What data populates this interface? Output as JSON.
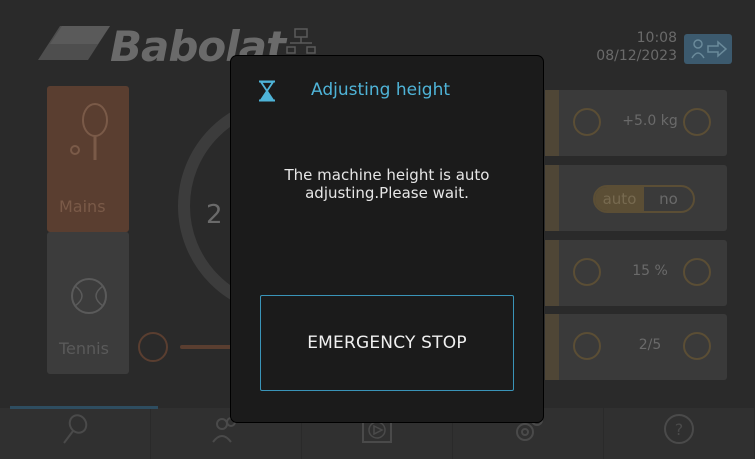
{
  "header": {
    "brand": "Babolat",
    "time": "10:08",
    "date": "08/12/2023"
  },
  "modes": [
    {
      "label": "Mains",
      "icon": "racket-icon",
      "selected": true
    },
    {
      "label": "Tennis",
      "icon": "tennis-ball-icon",
      "selected": false
    }
  ],
  "dial": {
    "value_fragment": "2"
  },
  "settings": {
    "weight": "+5.0 kg",
    "auto_toggle": {
      "on": "auto",
      "off": "no"
    },
    "percent": "15 %",
    "level": "2/5"
  },
  "modal": {
    "title": "Adjusting height",
    "message": "The machine height is auto adjusting.Please wait.",
    "stop_label": "EMERGENCY STOP",
    "title_color": "#4fb4d8",
    "border_color": "#3a94b8"
  },
  "colors": {
    "accent_orange": "#e8865a",
    "accent_yellow": "#f2d58a",
    "accent_blue": "#4fb4d8"
  }
}
